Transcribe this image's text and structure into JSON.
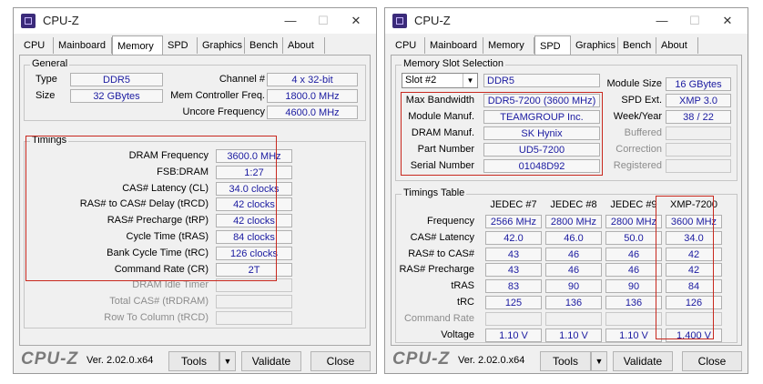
{
  "app": {
    "title": "CPU-Z",
    "logo": "CPU-Z",
    "version": "Ver. 2.02.0.x64"
  },
  "tabs": [
    "CPU",
    "Mainboard",
    "Memory",
    "SPD",
    "Graphics",
    "Bench",
    "About"
  ],
  "footer": {
    "tools": "Tools",
    "validate": "Validate",
    "close": "Close"
  },
  "window_controls": {
    "minimize": "—",
    "maximize": "☐",
    "close": "✕"
  },
  "memory": {
    "general_title": "General",
    "type_label": "Type",
    "type_value": "DDR5",
    "size_label": "Size",
    "size_value": "32 GBytes",
    "channel_label": "Channel #",
    "channel_value": "4 x 32-bit",
    "mcf_label": "Mem Controller Freq.",
    "mcf_value": "1800.0 MHz",
    "uncore_label": "Uncore Frequency",
    "uncore_value": "4600.0 MHz",
    "timings_title": "Timings",
    "timings": [
      {
        "label": "DRAM Frequency",
        "value": "3600.0 MHz"
      },
      {
        "label": "FSB:DRAM",
        "value": "1:27"
      },
      {
        "label": "CAS# Latency (CL)",
        "value": "34.0 clocks"
      },
      {
        "label": "RAS# to CAS# Delay (tRCD)",
        "value": "42 clocks"
      },
      {
        "label": "RAS# Precharge (tRP)",
        "value": "42 clocks"
      },
      {
        "label": "Cycle Time (tRAS)",
        "value": "84 clocks"
      },
      {
        "label": "Bank Cycle Time (tRC)",
        "value": "126 clocks"
      },
      {
        "label": "Command Rate (CR)",
        "value": "2T"
      },
      {
        "label": "DRAM Idle Timer",
        "value": ""
      },
      {
        "label": "Total CAS# (tRDRAM)",
        "value": ""
      },
      {
        "label": "Row To Column (tRCD)",
        "value": ""
      }
    ]
  },
  "spd": {
    "slot_title": "Memory Slot Selection",
    "slot_selected": "Slot #2",
    "module_type": "DDR5",
    "max_bw_label": "Max Bandwidth",
    "max_bw_value": "DDR5-7200 (3600 MHz)",
    "manuf_label": "Module Manuf.",
    "manuf_value": "TEAMGROUP Inc.",
    "dram_label": "DRAM Manuf.",
    "dram_value": "SK Hynix",
    "part_label": "Part Number",
    "part_value": "UD5-7200",
    "serial_label": "Serial Number",
    "serial_value": "01048D92",
    "msize_label": "Module Size",
    "msize_value": "16 GBytes",
    "ext_label": "SPD Ext.",
    "ext_value": "XMP 3.0",
    "week_label": "Week/Year",
    "week_value": "38 / 22",
    "buffered_label": "Buffered",
    "correction_label": "Correction",
    "registered_label": "Registered",
    "timings_table_title": "Timings Table",
    "columns": [
      "JEDEC #7",
      "JEDEC #8",
      "JEDEC #9",
      "XMP-7200"
    ],
    "rows": [
      {
        "label": "Frequency",
        "values": [
          "2566 MHz",
          "2800 MHz",
          "2800 MHz",
          "3600 MHz"
        ]
      },
      {
        "label": "CAS# Latency",
        "values": [
          "42.0",
          "46.0",
          "50.0",
          "34.0"
        ]
      },
      {
        "label": "RAS# to CAS#",
        "values": [
          "43",
          "46",
          "46",
          "42"
        ]
      },
      {
        "label": "RAS# Precharge",
        "values": [
          "43",
          "46",
          "46",
          "42"
        ]
      },
      {
        "label": "tRAS",
        "values": [
          "83",
          "90",
          "90",
          "84"
        ]
      },
      {
        "label": "tRC",
        "values": [
          "125",
          "136",
          "136",
          "126"
        ]
      },
      {
        "label": "Command Rate",
        "values": [
          "",
          "",
          "",
          ""
        ]
      },
      {
        "label": "Voltage",
        "values": [
          "1.10 V",
          "1.10 V",
          "1.10 V",
          "1.400 V"
        ]
      }
    ]
  }
}
